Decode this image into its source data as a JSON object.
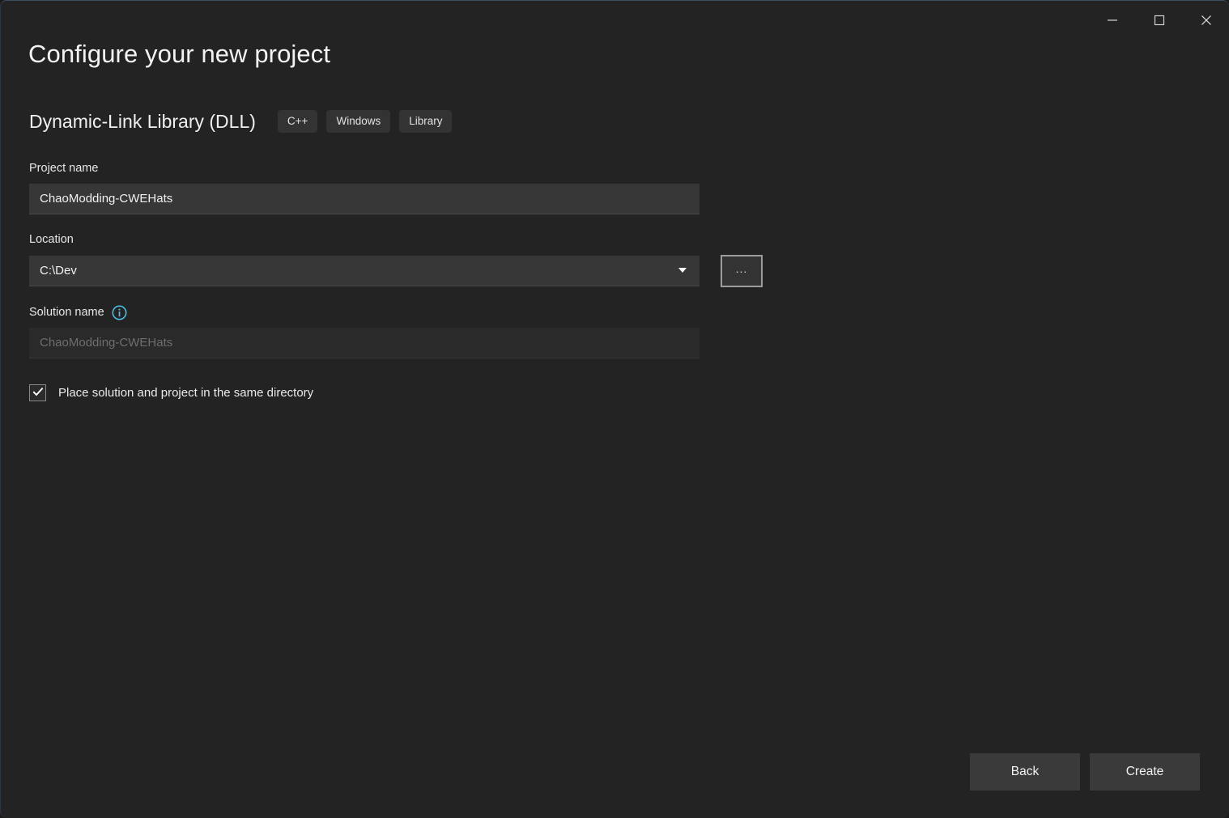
{
  "window": {
    "controls": {
      "minimize_label": "Minimize",
      "maximize_label": "Maximize",
      "close_label": "Close"
    },
    "background_color": "#232323"
  },
  "header": {
    "title": "Configure your new project",
    "template_name": "Dynamic-Link Library (DLL)",
    "tags": [
      "C++",
      "Windows",
      "Library"
    ],
    "tag_background_color": "#333333"
  },
  "form": {
    "project_name": {
      "label": "Project name",
      "value": "ChaoModding-CWEHats",
      "placeholder": ""
    },
    "location": {
      "label": "Location",
      "value": "C:\\Dev",
      "browse_label": "...",
      "dropdown_icon": "chevron-down-icon"
    },
    "solution_name": {
      "label": "Solution name",
      "value": "",
      "placeholder": "ChaoModding-CWEHats",
      "info_icon": "info-icon",
      "info_icon_color": "#4FC3E8",
      "disabled": true
    },
    "same_directory": {
      "label": "Place solution and project in the same directory",
      "checked": true
    }
  },
  "footer": {
    "back_label": "Back",
    "create_label": "Create"
  }
}
